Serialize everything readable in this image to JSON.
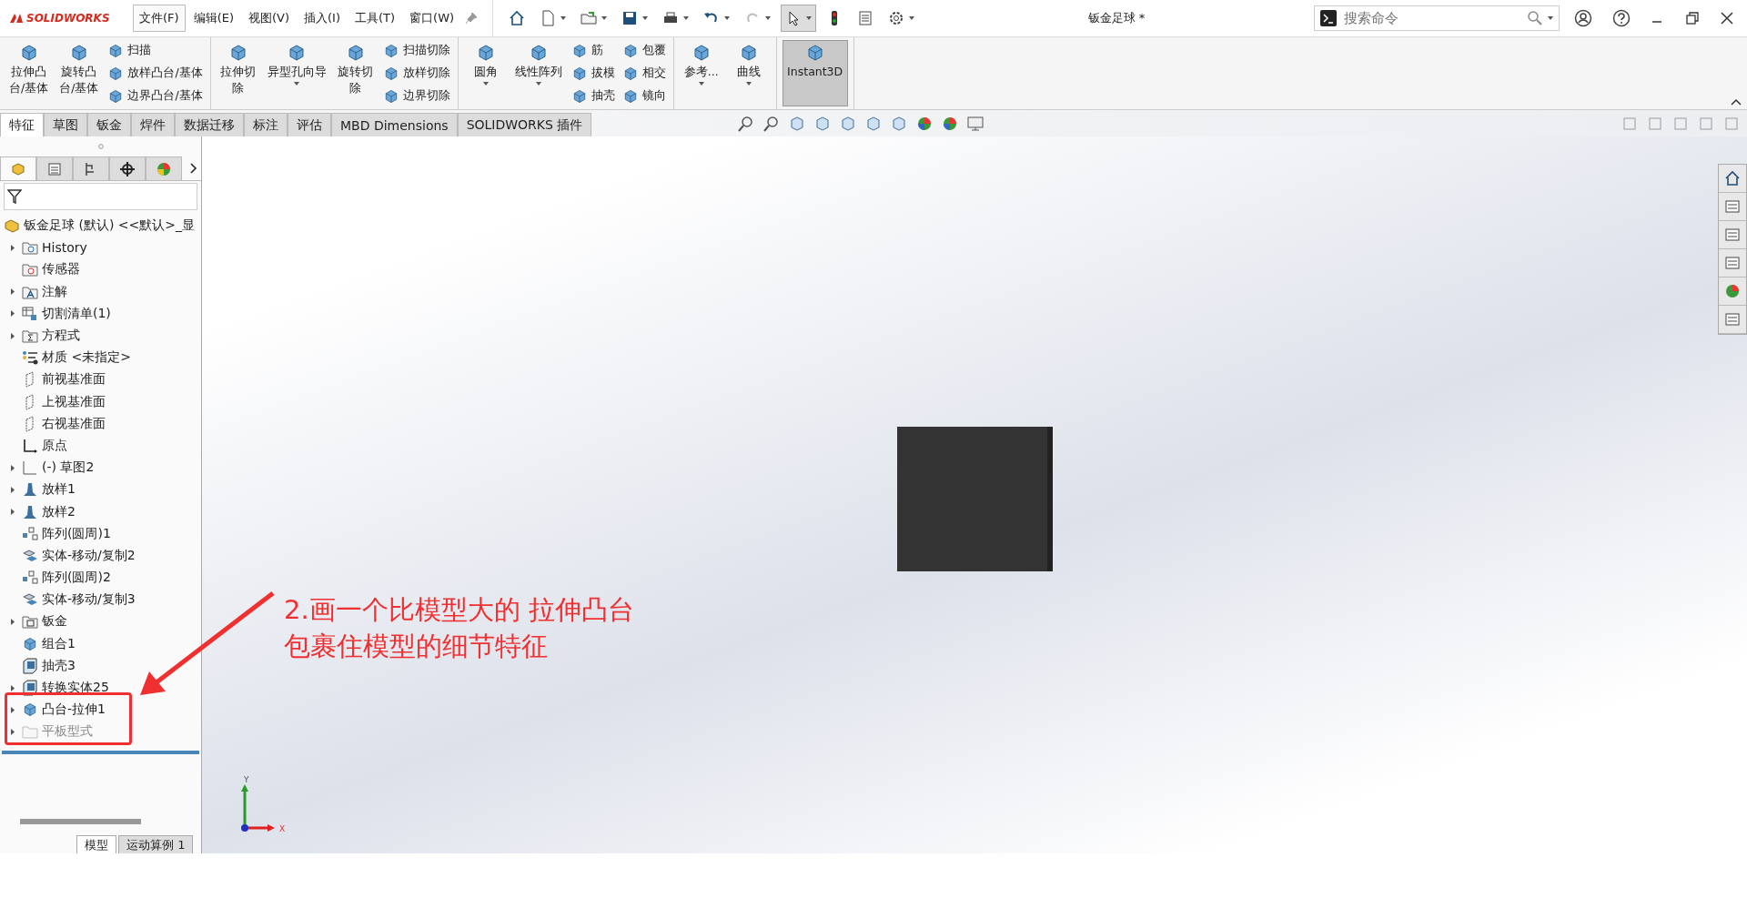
{
  "app": {
    "logo_text": "SOLIDWORKS"
  },
  "menu": [
    {
      "label": "文件(F)",
      "selected": true
    },
    {
      "label": "编辑(E)",
      "selected": false
    },
    {
      "label": "视图(V)",
      "selected": false
    },
    {
      "label": "插入(I)",
      "selected": false
    },
    {
      "label": "工具(T)",
      "selected": false
    },
    {
      "label": "窗口(W)",
      "selected": false
    }
  ],
  "window": {
    "title": "钣金足球 *"
  },
  "search": {
    "placeholder": "搜索命令"
  },
  "ribbon": {
    "groups": [
      {
        "items": [
          {
            "kind": "large",
            "lines": [
              "拉伸凸",
              "台/基体"
            ],
            "dropdown": false,
            "pressed": false
          },
          {
            "kind": "large",
            "lines": [
              "旋转凸",
              "台/基体"
            ],
            "dropdown": false,
            "pressed": false
          },
          {
            "kind": "stack",
            "labels": [
              "扫描",
              "放样凸台/基体",
              "边界凸台/基体"
            ]
          }
        ]
      },
      {
        "items": [
          {
            "kind": "large",
            "lines": [
              "拉伸切",
              "除"
            ],
            "dropdown": false,
            "pressed": false
          },
          {
            "kind": "large",
            "lines": [
              "异型孔向导"
            ],
            "dropdown": true,
            "pressed": false
          },
          {
            "kind": "large",
            "lines": [
              "旋转切",
              "除"
            ],
            "dropdown": false,
            "pressed": false
          },
          {
            "kind": "stack",
            "labels": [
              "扫描切除",
              "放样切除",
              "边界切除"
            ]
          }
        ]
      },
      {
        "items": [
          {
            "kind": "large",
            "lines": [
              "圆角"
            ],
            "dropdown": true,
            "pressed": false
          },
          {
            "kind": "large",
            "lines": [
              "线性阵列"
            ],
            "dropdown": true,
            "pressed": false
          },
          {
            "kind": "stack",
            "labels": [
              "筋",
              "拔模",
              "抽壳"
            ]
          },
          {
            "kind": "stack",
            "labels": [
              "包覆",
              "相交",
              "镜向"
            ]
          }
        ]
      },
      {
        "items": [
          {
            "kind": "large",
            "lines": [
              "参考..."
            ],
            "dropdown": true,
            "pressed": false
          },
          {
            "kind": "large",
            "lines": [
              "曲线"
            ],
            "dropdown": true,
            "pressed": false
          }
        ]
      },
      {
        "items": [
          {
            "kind": "large",
            "lines": [
              "Instant3D"
            ],
            "dropdown": false,
            "pressed": true
          }
        ]
      }
    ]
  },
  "tabs": [
    {
      "label": "特征",
      "selected": true
    },
    {
      "label": "草图",
      "selected": false
    },
    {
      "label": "钣金",
      "selected": false
    },
    {
      "label": "焊件",
      "selected": false
    },
    {
      "label": "数据迁移",
      "selected": false
    },
    {
      "label": "标注",
      "selected": false
    },
    {
      "label": "评估",
      "selected": false
    },
    {
      "label": "MBD Dimensions",
      "selected": false
    },
    {
      "label": "SOLIDWORKS 插件",
      "selected": false
    }
  ],
  "panel_tabs": [
    {
      "selected": true
    },
    {
      "selected": false
    },
    {
      "selected": false
    },
    {
      "selected": false
    },
    {
      "selected": false
    }
  ],
  "tree": {
    "label": "钣金足球 (默认) <<默认>_显",
    "children": [
      {
        "label": "History",
        "kind": "history",
        "has_children": true,
        "disabled": false
      },
      {
        "label": "传感器",
        "kind": "sensor",
        "has_children": false,
        "disabled": false
      },
      {
        "label": "注解",
        "kind": "annotation",
        "has_children": true,
        "disabled": false
      },
      {
        "label": "切割清单(1)",
        "kind": "cutlist",
        "has_children": true,
        "disabled": false
      },
      {
        "label": "方程式",
        "kind": "equation",
        "has_children": true,
        "disabled": false
      },
      {
        "label": "材质 <未指定>",
        "kind": "material",
        "has_children": false,
        "disabled": false
      },
      {
        "label": "前视基准面",
        "kind": "plane",
        "has_children": false,
        "disabled": false
      },
      {
        "label": "上视基准面",
        "kind": "plane",
        "has_children": false,
        "disabled": false
      },
      {
        "label": "右视基准面",
        "kind": "plane",
        "has_children": false,
        "disabled": false
      },
      {
        "label": "原点",
        "kind": "origin",
        "has_children": false,
        "disabled": false
      },
      {
        "label": "(-) 草图2",
        "kind": "sketch",
        "has_children": true,
        "disabled": false
      },
      {
        "label": "放样1",
        "kind": "loft",
        "has_children": true,
        "disabled": false
      },
      {
        "label": "放样2",
        "kind": "loft",
        "has_children": true,
        "disabled": false
      },
      {
        "label": "阵列(圆周)1",
        "kind": "pattern",
        "has_children": false,
        "disabled": false
      },
      {
        "label": "实体-移动/复制2",
        "kind": "move",
        "has_children": false,
        "disabled": false
      },
      {
        "label": "阵列(圆周)2",
        "kind": "pattern",
        "has_children": false,
        "disabled": false
      },
      {
        "label": "实体-移动/复制3",
        "kind": "move",
        "has_children": false,
        "disabled": false
      },
      {
        "label": "钣金",
        "kind": "sheetmetal",
        "has_children": true,
        "disabled": false
      },
      {
        "label": "组合1",
        "kind": "body",
        "has_children": false,
        "disabled": false
      },
      {
        "label": "抽壳3",
        "kind": "shell",
        "has_children": false,
        "disabled": false
      },
      {
        "label": "转换实体25",
        "kind": "shell",
        "has_children": true,
        "disabled": false
      },
      {
        "label": "凸台-拉伸1",
        "kind": "body",
        "has_children": true,
        "disabled": false
      },
      {
        "label": "平板型式",
        "kind": "flat",
        "has_children": true,
        "disabled": true
      }
    ]
  },
  "annotation": {
    "lines": [
      "2.画一个比模型大的 拉伸凸台",
      "包裹住模型的细节特征"
    ]
  },
  "triad": {
    "y_label": "Y",
    "x_label": "X"
  },
  "bottom_tabs": [
    {
      "label": "模型",
      "selected": true
    },
    {
      "label": "运动算例 1",
      "selected": false
    }
  ]
}
